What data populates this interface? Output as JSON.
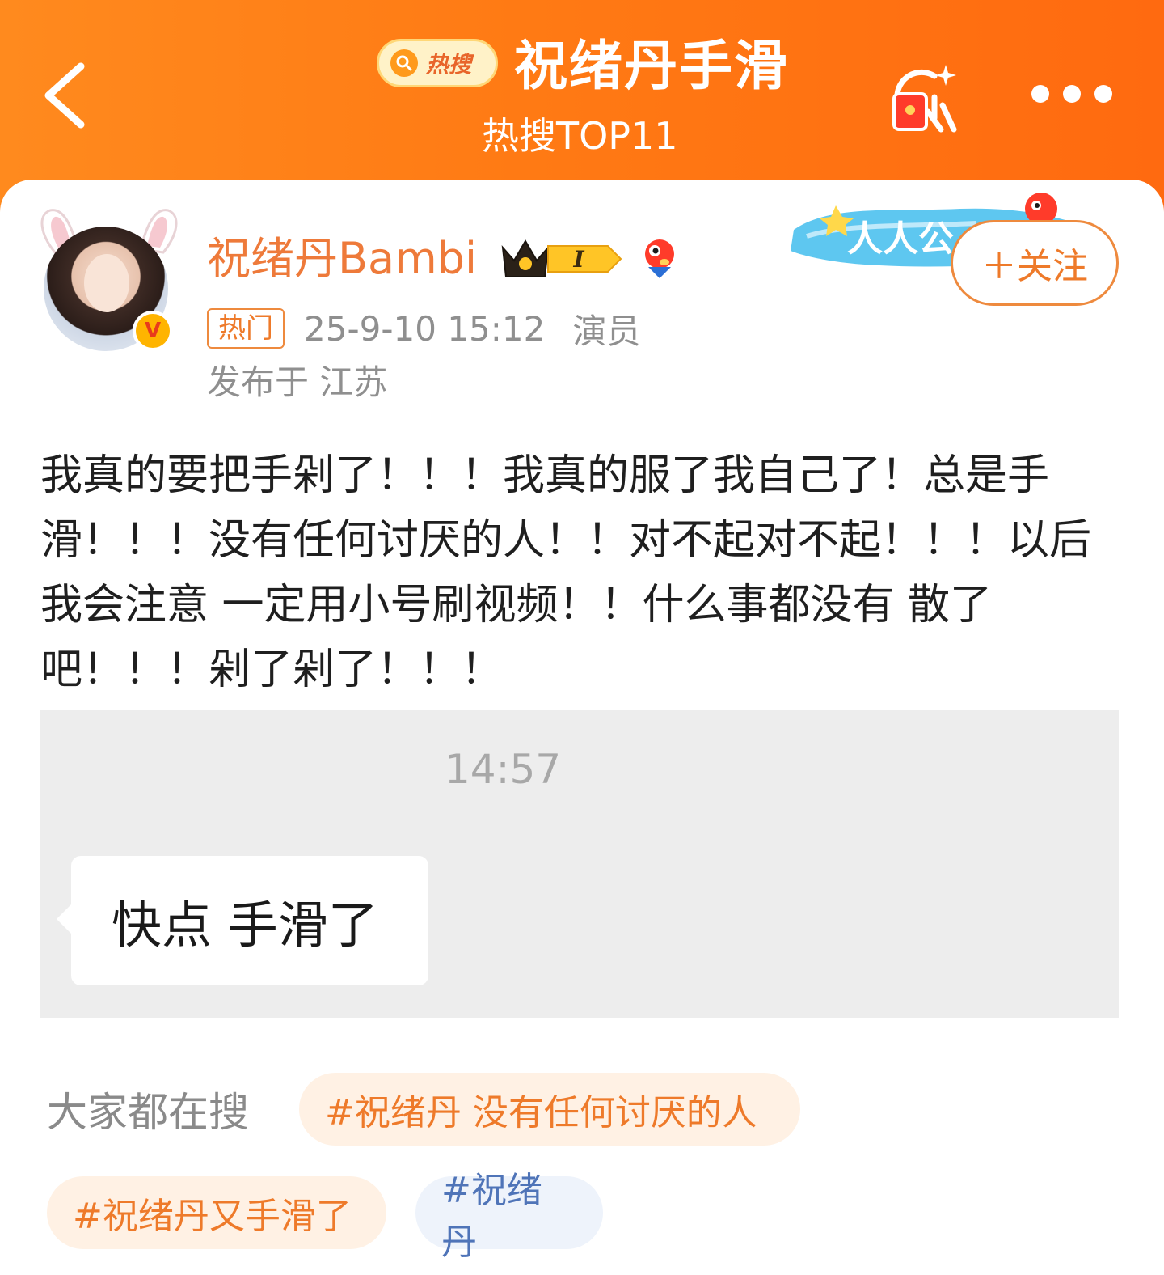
{
  "header": {
    "hot_badge": "热搜",
    "topic_title": "祝绪丹手滑",
    "topic_rank": "热搜TOP11"
  },
  "post": {
    "author": "祝绪丹Bambi",
    "hot_tag": "热门",
    "time": "25-9-10 15:12",
    "role": "演员",
    "location": "发布于 江苏",
    "follow_label": "＋关注",
    "banner_text": "人人公",
    "badge_level": "I",
    "body": "我真的要把手剁了！！！我真的服了我自己了！总是手滑！！！没有任何讨厌的人！！对不起对不起！！！以后我会注意 一定用小号刷视频！！什么事都没有 散了吧！！！剁了剁了！！！",
    "image": {
      "chat_time": "14:57",
      "chat_message": "快点 手滑了"
    }
  },
  "trending": {
    "label": "大家都在搜",
    "tags": [
      {
        "text": "#祝绪丹 没有任何讨厌的人",
        "style": "orange"
      },
      {
        "text": "#祝绪丹又手滑了",
        "style": "orange"
      },
      {
        "text": "#祝绪丹",
        "style": "blue"
      }
    ]
  },
  "colors": {
    "header_orange": "#ff7a14",
    "accent": "#ee7a2a",
    "link_blue": "#4f74b8"
  },
  "icons": [
    "back-arrow-icon",
    "search-icon",
    "red-envelope-search-icon",
    "more-dots-icon",
    "crown-icon",
    "mascot-icon",
    "verified-icon"
  ]
}
